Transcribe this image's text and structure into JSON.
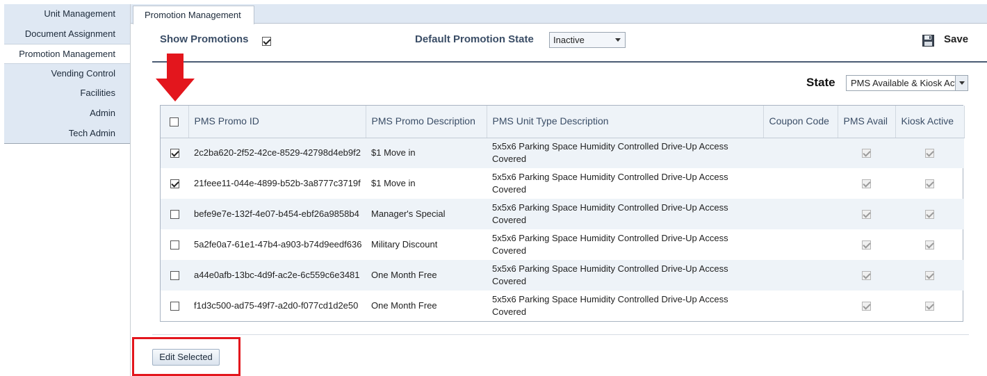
{
  "sidebar": {
    "items": [
      {
        "label": "Unit Management",
        "active": false
      },
      {
        "label": "Document Assignment",
        "active": false
      },
      {
        "label": "Promotion Management",
        "active": true
      },
      {
        "label": "Vending Control",
        "active": false
      },
      {
        "label": "Facilities",
        "active": false
      },
      {
        "label": "Admin",
        "active": false
      },
      {
        "label": "Tech Admin",
        "active": false
      }
    ]
  },
  "tab": {
    "label": "Promotion Management"
  },
  "toolbar": {
    "show_promotions_label": "Show Promotions",
    "show_promotions_checked": true,
    "default_state_label": "Default Promotion State",
    "default_state_value": "Inactive",
    "save_label": "Save"
  },
  "filter": {
    "state_label": "State",
    "state_value": "PMS Available & Kiosk Active"
  },
  "grid": {
    "headers": {
      "promo_id": "PMS Promo ID",
      "promo_desc": "PMS Promo Description",
      "unit_type": "PMS Unit Type Description",
      "coupon": "Coupon Code",
      "pms_avail": "PMS Avail",
      "kiosk_active": "Kiosk Active"
    },
    "rows": [
      {
        "selected": true,
        "promo_id": "2c2ba620-2f52-42ce-8529-42798d4eb9f2",
        "promo_desc": "$1 Move in",
        "unit_type": "5x5x6 Parking Space Humidity Controlled Drive-Up Access Covered",
        "coupon": "",
        "pms_avail": true,
        "kiosk_active": true
      },
      {
        "selected": true,
        "promo_id": "21feee11-044e-4899-b52b-3a8777c3719f",
        "promo_desc": "$1 Move in",
        "unit_type": "5x5x6 Parking Space Humidity Controlled Drive-Up Access Covered",
        "coupon": "",
        "pms_avail": true,
        "kiosk_active": true
      },
      {
        "selected": false,
        "promo_id": "befe9e7e-132f-4e07-b454-ebf26a9858b4",
        "promo_desc": "Manager's Special",
        "unit_type": "5x5x6 Parking Space Humidity Controlled Drive-Up Access Covered",
        "coupon": "",
        "pms_avail": true,
        "kiosk_active": true
      },
      {
        "selected": false,
        "promo_id": "5a2fe0a7-61e1-47b4-a903-b74d9eedf636",
        "promo_desc": "Military Discount",
        "unit_type": "5x5x6 Parking Space Humidity Controlled Drive-Up Access Covered",
        "coupon": "",
        "pms_avail": true,
        "kiosk_active": true
      },
      {
        "selected": false,
        "promo_id": "a44e0afb-13bc-4d9f-ac2e-6c559c6e3481",
        "promo_desc": "One Month Free",
        "unit_type": "5x5x6 Parking Space Humidity Controlled Drive-Up Access Covered",
        "coupon": "",
        "pms_avail": true,
        "kiosk_active": true
      },
      {
        "selected": false,
        "promo_id": "f1d3c500-ad75-49f7-a2d0-f077cd1d2e50",
        "promo_desc": "One Month Free",
        "unit_type": "5x5x6 Parking Space Humidity Controlled Drive-Up Access Covered",
        "coupon": "",
        "pms_avail": true,
        "kiosk_active": true
      }
    ]
  },
  "footer": {
    "edit_selected_label": "Edit Selected"
  },
  "colors": {
    "annotation_red": "#e3161d",
    "header_text": "#3a4d66",
    "sidebar_bg": "#dfe8f3"
  }
}
